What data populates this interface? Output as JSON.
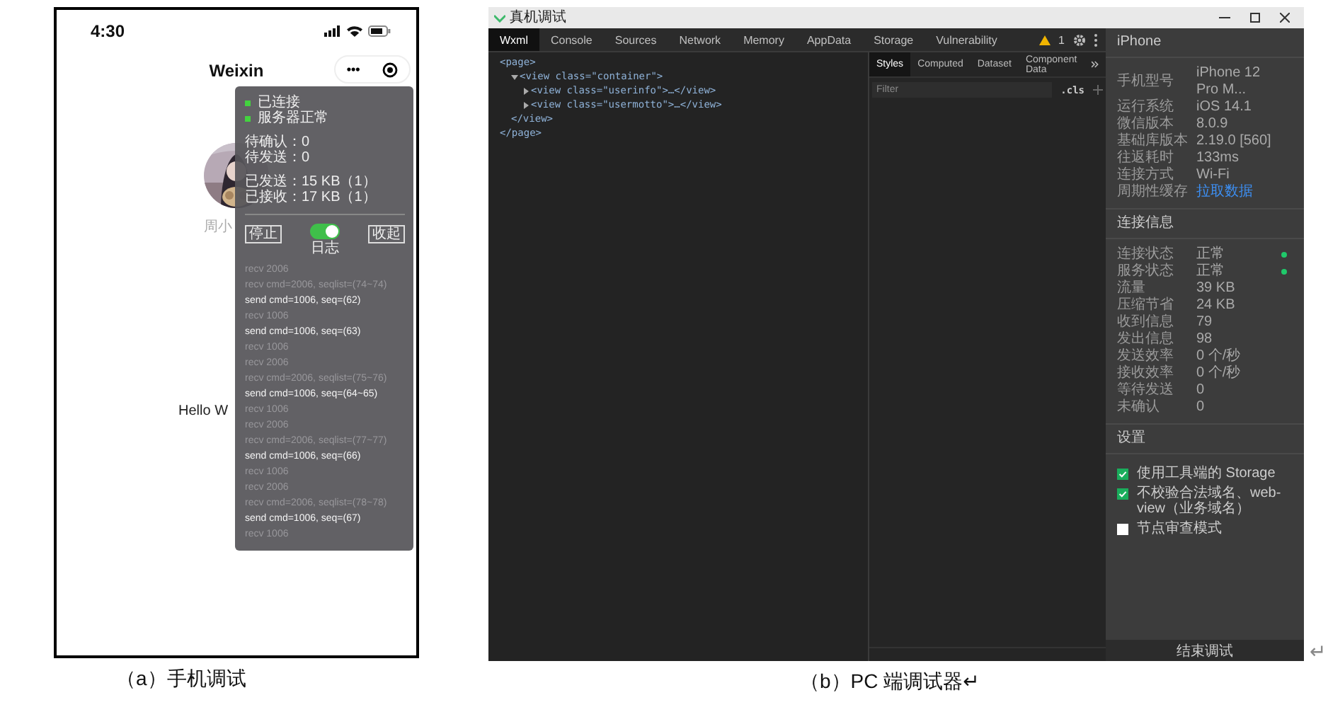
{
  "phone": {
    "time": "4:30",
    "title": "Weixin",
    "menu_button": "•••",
    "avatar_name": "周小",
    "motto": "Hello W",
    "vconsole": {
      "status": [
        {
          "label": "已连接",
          "color": "#43d33f"
        },
        {
          "label": "服务器正常",
          "color": "#43d33f"
        }
      ],
      "counters": [
        "待确认：0",
        "待发送：0"
      ],
      "traffic": [
        "已发送：15 KB（1）",
        "已接收：17 KB（1）"
      ],
      "stop_button": "停止",
      "log_toggle": {
        "label": "日志",
        "on": true
      },
      "collapse_button": "收起",
      "logs": [
        {
          "kind": "recv",
          "text": "recv 2006"
        },
        {
          "kind": "recv",
          "text": "recv cmd=2006, seqlist=(74~74)"
        },
        {
          "kind": "send",
          "text": "send cmd=1006, seq=(62)"
        },
        {
          "kind": "recv",
          "text": "recv 1006"
        },
        {
          "kind": "send",
          "text": "send cmd=1006, seq=(63)"
        },
        {
          "kind": "recv",
          "text": "recv 1006"
        },
        {
          "kind": "recv",
          "text": "recv 2006"
        },
        {
          "kind": "recv",
          "text": "recv cmd=2006, seqlist=(75~76)"
        },
        {
          "kind": "send",
          "text": "send cmd=1006, seq=(64~65)"
        },
        {
          "kind": "recv",
          "text": "recv 1006"
        },
        {
          "kind": "recv",
          "text": "recv 2006"
        },
        {
          "kind": "recv",
          "text": "recv cmd=2006, seqlist=(77~77)"
        },
        {
          "kind": "send",
          "text": "send cmd=1006, seq=(66)"
        },
        {
          "kind": "recv",
          "text": "recv 1006"
        },
        {
          "kind": "recv",
          "text": "recv 2006"
        },
        {
          "kind": "recv",
          "text": "recv cmd=2006, seqlist=(78~78)"
        },
        {
          "kind": "send",
          "text": "send cmd=1006, seq=(67)"
        },
        {
          "kind": "recv",
          "text": "recv 1006"
        }
      ]
    }
  },
  "devtools": {
    "window": {
      "title": "真机调试"
    },
    "tabs": [
      {
        "label": "Wxml",
        "selected": true
      },
      {
        "label": "Console",
        "selected": false
      },
      {
        "label": "Sources",
        "selected": false
      },
      {
        "label": "Network",
        "selected": false
      },
      {
        "label": "Memory",
        "selected": false
      },
      {
        "label": "AppData",
        "selected": false
      },
      {
        "label": "Storage",
        "selected": false
      },
      {
        "label": "Vulnerability",
        "selected": false
      }
    ],
    "warning_count": "1",
    "elements": [
      {
        "open": "<page>",
        "close": "</page>",
        "children": [
          {
            "open": "<view class=\"container\">",
            "expanded": true,
            "close": "</view>",
            "children": [
              {
                "open": "<view class=\"userinfo\">…</view>",
                "expanded": false
              },
              {
                "open": "<view class=\"usermotto\">…</view>",
                "expanded": false
              }
            ]
          }
        ]
      }
    ],
    "style_tabs": [
      {
        "label": "Styles",
        "selected": true
      },
      {
        "label": "Computed",
        "selected": false
      },
      {
        "label": "Dataset",
        "selected": false
      },
      {
        "label": "Component Data",
        "selected": false
      }
    ],
    "filter": {
      "placeholder": "Filter"
    },
    "cls_button": ".cls",
    "device": {
      "heading": "iPhone",
      "rows": [
        {
          "label": "手机型号",
          "value": "iPhone 12 Pro M...",
          "kind": "text"
        },
        {
          "label": "运行系统",
          "value": "iOS 14.1",
          "kind": "text"
        },
        {
          "label": "微信版本",
          "value": "8.0.9",
          "kind": "text"
        },
        {
          "label": "基础库版本",
          "value": "2.19.0 [560]",
          "kind": "text"
        },
        {
          "label": "往返耗时",
          "value": "133ms",
          "kind": "text"
        },
        {
          "label": "连接方式",
          "value": "Wi-Fi",
          "kind": "text"
        },
        {
          "label": "周期性缓存",
          "value": "拉取数据",
          "kind": "link"
        }
      ]
    },
    "connection": {
      "heading": "连接信息",
      "rows": [
        {
          "label": "连接状态",
          "value": "正常",
          "color": "#1fc96a"
        },
        {
          "label": "服务状态",
          "value": "正常",
          "color": "#1fc96a"
        },
        {
          "label": "流量",
          "value": "39 KB"
        },
        {
          "label": "压缩节省",
          "value": "24 KB"
        },
        {
          "label": "收到信息",
          "value": "79"
        },
        {
          "label": "发出信息",
          "value": "98"
        },
        {
          "label": "发送效率",
          "value": "0 个/秒"
        },
        {
          "label": "接收效率",
          "value": "0 个/秒"
        },
        {
          "label": "等待发送",
          "value": "0"
        },
        {
          "label": "未确认",
          "value": "0"
        }
      ]
    },
    "settings": {
      "heading": "设置",
      "options": [
        {
          "label": "使用工具端的 Storage",
          "checked": true
        },
        {
          "label": "不校验合法域名、web-view（业务域名）",
          "checked": true
        },
        {
          "label": "节点审查模式",
          "checked": false
        }
      ]
    },
    "end_button": "结束调试"
  },
  "captions": [
    "（a）手机调试",
    "（b）PC 端调试器↵"
  ],
  "paragraph_mark": "↵"
}
